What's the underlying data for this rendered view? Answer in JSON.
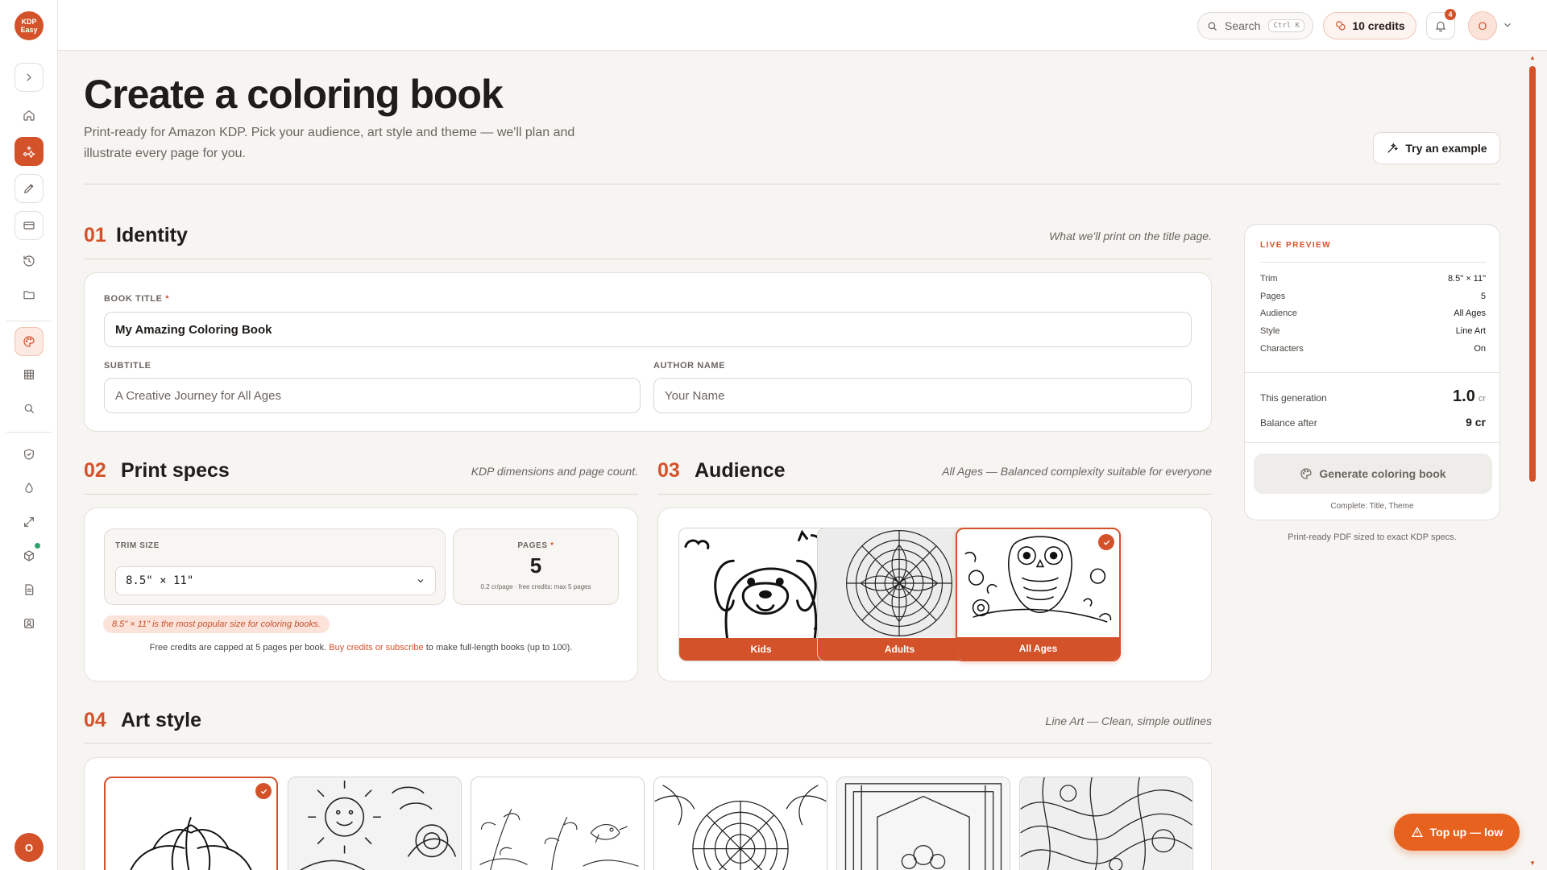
{
  "app": {
    "logo_text": "KDP Easy",
    "accent": "#d4522a"
  },
  "sidebar": {
    "items": [
      {
        "name": "expand",
        "icon": "chevron-right-icon"
      },
      {
        "name": "home",
        "icon": "home-icon"
      },
      {
        "name": "create",
        "icon": "sparkles-icon",
        "active": true
      },
      {
        "name": "write",
        "icon": "pen-icon"
      },
      {
        "name": "billing",
        "icon": "credit-card-icon"
      },
      {
        "name": "history",
        "icon": "history-icon"
      },
      {
        "name": "library",
        "icon": "folder-icon"
      },
      {
        "name": "coloring",
        "icon": "palette-icon",
        "soft": true
      },
      {
        "name": "grid",
        "icon": "grid-icon"
      },
      {
        "name": "search",
        "icon": "search-icon"
      },
      {
        "name": "security",
        "icon": "shield-icon"
      },
      {
        "name": "theme",
        "icon": "droplet-icon"
      },
      {
        "name": "resize",
        "icon": "maximize-icon"
      },
      {
        "name": "packages",
        "icon": "package-icon"
      },
      {
        "name": "docs",
        "icon": "document-icon"
      },
      {
        "name": "account",
        "icon": "contact-icon"
      }
    ],
    "user_initial": "O"
  },
  "topbar": {
    "search_label": "Search",
    "search_shortcut": "Ctrl K",
    "credits_label": "10 credits",
    "notification_count": "4",
    "avatar_initial": "O"
  },
  "header": {
    "title": "Create a coloring book",
    "subtitle": "Print-ready for Amazon KDP. Pick your audience, art style and theme — we'll plan and illustrate every page for you.",
    "try_example": "Try an example"
  },
  "identity": {
    "num": "01",
    "title": "Identity",
    "hint": "What we'll print on the title page.",
    "book_title_label": "BOOK TITLE",
    "required_mark": "*",
    "book_title_value": "My Amazing Coloring Book",
    "subtitle_label": "SUBTITLE",
    "subtitle_placeholder": "A Creative Journey for All Ages",
    "author_label": "AUTHOR NAME",
    "author_placeholder": "Your Name"
  },
  "print_specs": {
    "num": "02",
    "title": "Print specs",
    "hint": "KDP dimensions and page count.",
    "trim_label": "TRIM SIZE",
    "trim_value": "8.5\" × 11\"",
    "pages_label": "PAGES",
    "pages_value": "5",
    "pages_note": "0.2 cr/page · free credits: max 5 pages",
    "tip": "8.5\" × 11\" is the most popular size for coloring books.",
    "free_note_pre": "Free credits are capped at 5 pages per book.",
    "free_note_link": "Buy credits or subscribe",
    "free_note_post": "to make full-length books (up to 100)."
  },
  "audience": {
    "num": "03",
    "title": "Audience",
    "hint": "All Ages — Balanced complexity suitable for everyone",
    "options": [
      {
        "label": "Kids",
        "selected": false
      },
      {
        "label": "Adults",
        "selected": false
      },
      {
        "label": "All Ages",
        "selected": true
      }
    ]
  },
  "art_style": {
    "num": "04",
    "title": "Art style",
    "hint": "Line Art — Clean, simple outlines",
    "selected_index": 0
  },
  "preview": {
    "title": "LIVE PREVIEW",
    "rows": [
      {
        "k": "Trim",
        "v": "8.5\" × 11\""
      },
      {
        "k": "Pages",
        "v": "5"
      },
      {
        "k": "Audience",
        "v": "All Ages"
      },
      {
        "k": "Style",
        "v": "Line Art"
      },
      {
        "k": "Characters",
        "v": "On"
      }
    ],
    "this_gen_label": "This generation",
    "this_gen_value": "1.0",
    "this_gen_unit": "cr",
    "balance_label": "Balance after",
    "balance_value": "9 cr",
    "generate_label": "Generate coloring book",
    "complete_note": "Complete: Title, Theme",
    "footer": "Print-ready PDF sized to exact KDP specs."
  },
  "topup": {
    "label": "Top up — low"
  }
}
